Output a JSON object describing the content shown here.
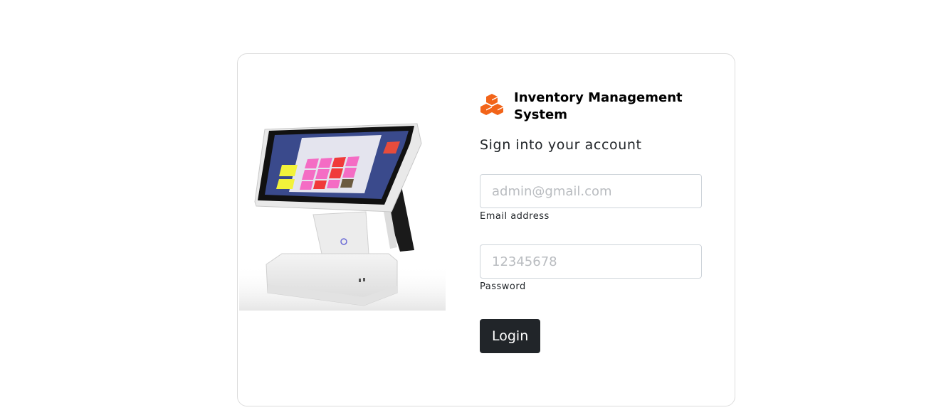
{
  "brand": {
    "title": "Inventory Management System",
    "icon": "boxes-icon",
    "accent_color": "#f26419"
  },
  "form": {
    "heading": "Sign into your account",
    "email": {
      "placeholder": "admin@gmail.com",
      "value": "",
      "label": "Email address"
    },
    "password": {
      "placeholder": "12345678",
      "value": "",
      "label": "Password"
    },
    "submit_label": "Login",
    "button_color": "#212529"
  },
  "illustration": {
    "icon": "pos-terminal-illustration"
  }
}
